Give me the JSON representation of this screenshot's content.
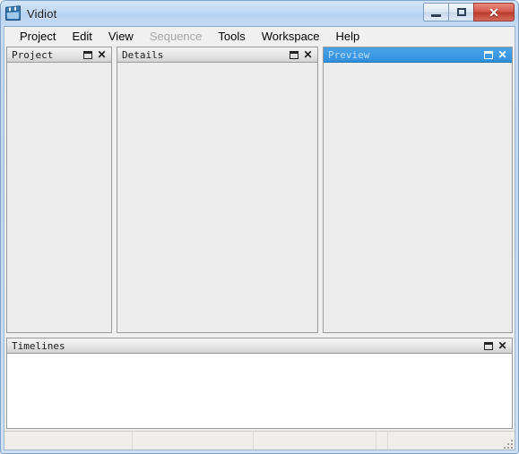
{
  "window": {
    "title": "Vidiot",
    "icon": "film-slate-icon",
    "controls": [
      {
        "name": "minimize",
        "glyph": "—"
      },
      {
        "name": "maximize",
        "glyph": "▣"
      },
      {
        "name": "close",
        "glyph": "✕"
      }
    ],
    "accent_title_bar": "#bed6f0",
    "accent_close_button": "#c0392b"
  },
  "menu": {
    "items": [
      {
        "label": "Project",
        "disabled": false
      },
      {
        "label": "Edit",
        "disabled": false
      },
      {
        "label": "View",
        "disabled": false
      },
      {
        "label": "Sequence",
        "disabled": true
      },
      {
        "label": "Tools",
        "disabled": false
      },
      {
        "label": "Workspace",
        "disabled": false
      },
      {
        "label": "Help",
        "disabled": false
      }
    ]
  },
  "panes": {
    "project": {
      "title": "Project",
      "active": false,
      "body": "",
      "float_label": "float",
      "close_label": "✕"
    },
    "details": {
      "title": "Details",
      "active": false,
      "body": "",
      "float_label": "float",
      "close_label": "✕"
    },
    "preview": {
      "title": "Preview",
      "active": true,
      "body": "",
      "float_label": "float",
      "close_label": "✕"
    },
    "timelines": {
      "title": "Timelines",
      "active": false,
      "body": "",
      "float_label": "float",
      "close_label": "✕"
    }
  },
  "status_bar": {
    "fields": [
      "",
      "",
      "",
      ""
    ],
    "grip": "resize-grip"
  }
}
